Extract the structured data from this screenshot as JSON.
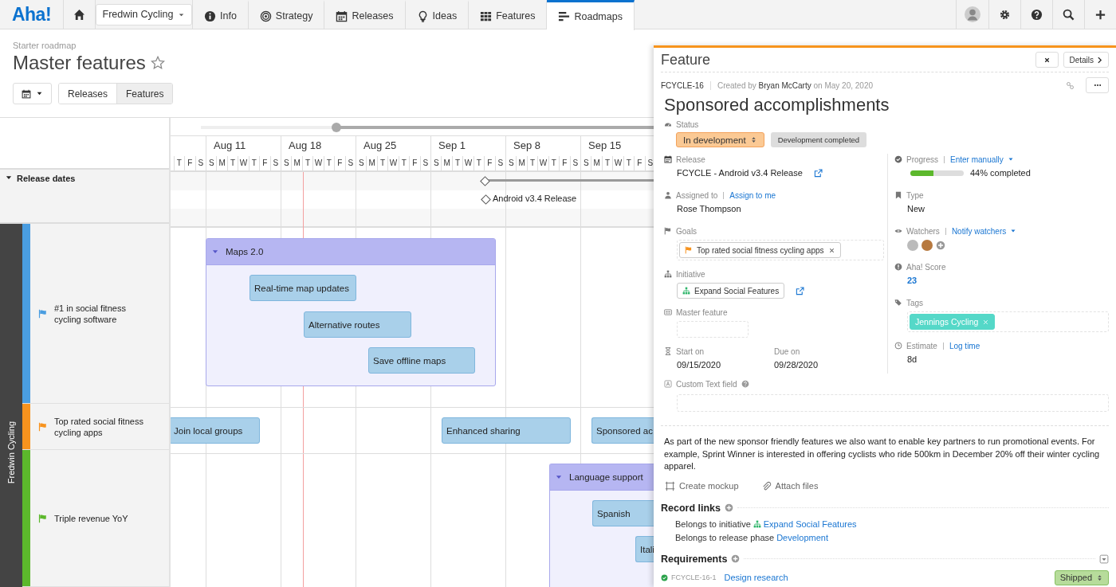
{
  "nav": {
    "logo": "Aha!",
    "workspace": "Fredwin Cycling",
    "tabs": [
      {
        "label": "Info",
        "selected": false
      },
      {
        "label": "Strategy",
        "selected": false
      },
      {
        "label": "Releases",
        "selected": false
      },
      {
        "label": "Ideas",
        "selected": false
      },
      {
        "label": "Features",
        "selected": false
      },
      {
        "label": "Roadmaps",
        "selected": true
      }
    ]
  },
  "page": {
    "breadcrumb": "Starter roadmap",
    "title": "Master features",
    "starred": false,
    "views": [
      {
        "label": "Releases",
        "selected": false
      },
      {
        "label": "Features",
        "selected": true
      }
    ]
  },
  "timeline": {
    "range_slider": {
      "level": 0.3
    },
    "weeks": [
      "Aug 11",
      "Aug 18",
      "Aug 25",
      "Sep 1",
      "Sep 8",
      "Sep 15"
    ],
    "days": [
      "T",
      "F",
      "S",
      "S",
      "M",
      "T",
      "W",
      "T",
      "F",
      "S",
      "S",
      "M",
      "T",
      "W",
      "T",
      "F",
      "S",
      "S",
      "M",
      "T",
      "W",
      "T",
      "F",
      "S",
      "S",
      "M",
      "T",
      "W",
      "T",
      "F",
      "S",
      "S",
      "M",
      "T",
      "W",
      "T",
      "F",
      "S",
      "S",
      "M",
      "T",
      "W",
      "T",
      "F",
      "S"
    ]
  },
  "release_row": {
    "label": "Release dates",
    "expanded": true,
    "release": "Android v3.4 Release"
  },
  "workspace_lane": {
    "label": "Fredwin Cycling"
  },
  "lanes": [
    {
      "goal": "#1 in social fitness cycling software",
      "color": "#4a9de0",
      "items": [
        {
          "kind": "group",
          "label": "Maps 2.0",
          "expanded": true,
          "children": [
            {
              "label": "Real-time map updates"
            },
            {
              "label": "Alternative routes"
            },
            {
              "label": "Save offline maps"
            }
          ]
        }
      ]
    },
    {
      "goal": "Top rated social fitness cycling apps",
      "color": "#f7931e",
      "items": [
        {
          "kind": "feature",
          "label": "Join local groups"
        },
        {
          "kind": "feature",
          "label": "Enhanced sharing"
        },
        {
          "kind": "feature",
          "label": "Sponsored ac"
        }
      ]
    },
    {
      "goal": "Triple revenue YoY",
      "color": "#5cb82c",
      "items": [
        {
          "kind": "group",
          "label": "Language support",
          "expanded": true,
          "children": [
            {
              "label": "Spanish"
            },
            {
              "label": "Itali"
            }
          ]
        }
      ]
    }
  ],
  "panel": {
    "heading": "Feature",
    "details": "Details",
    "id": "FCYCLE-16",
    "created": {
      "prefix": "Created by",
      "author": "Bryan McCarty",
      "suffix": "on May 20, 2020"
    },
    "title": "Sponsored accomplishments",
    "status": {
      "label": "Status",
      "options": [
        {
          "label": "In development",
          "selected": true
        },
        {
          "label": "Development completed",
          "selected": false
        }
      ]
    },
    "release": {
      "label": "Release",
      "value": "FCYCLE - Android v3.4 Release"
    },
    "assigned": {
      "label": "Assigned to",
      "action": "Assign to me",
      "value": "Rose Thompson"
    },
    "goals": {
      "label": "Goals",
      "tags": [
        "Top rated social fitness cycling apps"
      ]
    },
    "initiative": {
      "label": "Initiative",
      "value": "Expand Social Features"
    },
    "master_feature": {
      "label": "Master feature"
    },
    "start": {
      "label": "Start on",
      "value": "09/15/2020"
    },
    "due": {
      "label": "Due on",
      "value": "09/28/2020"
    },
    "progress": {
      "label": "Progress",
      "action": "Enter manually",
      "level": 0.44,
      "reading": "44% completed"
    },
    "type": {
      "label": "Type",
      "value": "New"
    },
    "watchers": {
      "label": "Watchers",
      "action": "Notify watchers"
    },
    "score": {
      "label": "Aha! Score",
      "value": "23"
    },
    "tags": {
      "label": "Tags",
      "tags": [
        "Jennings Cycling"
      ]
    },
    "estimate": {
      "label": "Estimate",
      "action": "Log time",
      "value": "8d"
    },
    "custom_field": {
      "label": "Custom Text field"
    },
    "description": "As part of the new sponsor friendly features we also want to enable key partners to run promotional events. For example, Sprint Winner is interested in offering cyclists who ride 500km in December 20% off their winter cycling apparel.",
    "actions": [
      {
        "kind": "mockup",
        "label": "Create mockup"
      },
      {
        "kind": "attach",
        "label": "Attach files"
      }
    ],
    "record_links": {
      "title": "Record links",
      "links": [
        {
          "kind": "initiative",
          "text": "Belongs to initiative",
          "link": "Expand Social Features"
        },
        {
          "kind": "phase",
          "text": "Belongs to release phase",
          "link": "Development"
        }
      ]
    },
    "requirements": {
      "title": "Requirements",
      "items": [
        {
          "id": "FCYCLE-16-1",
          "name": "Design research",
          "status": "Shipped",
          "done": true
        }
      ]
    }
  }
}
